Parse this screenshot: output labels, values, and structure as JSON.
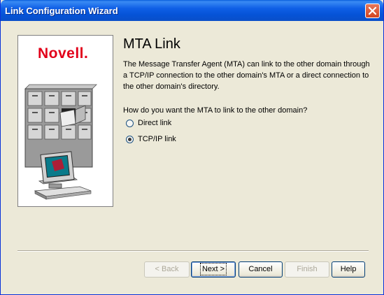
{
  "window": {
    "title": "Link Configuration Wizard"
  },
  "logo": {
    "text": "Novell."
  },
  "page": {
    "heading": "MTA Link",
    "description": "The Message Transfer Agent (MTA) can link to the other domain through a TCP/IP connection to the other domain's MTA or a direct connection to the other domain's directory.",
    "question": "How do you want the MTA to link to the other domain?"
  },
  "options": [
    {
      "label": "Direct link",
      "checked": false
    },
    {
      "label": "TCP/IP link",
      "checked": true
    }
  ],
  "buttons": {
    "back": "< Back",
    "next": "Next >",
    "cancel": "Cancel",
    "finish": "Finish",
    "help": "Help"
  },
  "colors": {
    "title_bar": "#0553d7",
    "logo_red": "#e2001a",
    "window_bg": "#ece9d8"
  },
  "icons": [
    "close-icon",
    "filing-cabinet-icon",
    "computer-icon"
  ]
}
